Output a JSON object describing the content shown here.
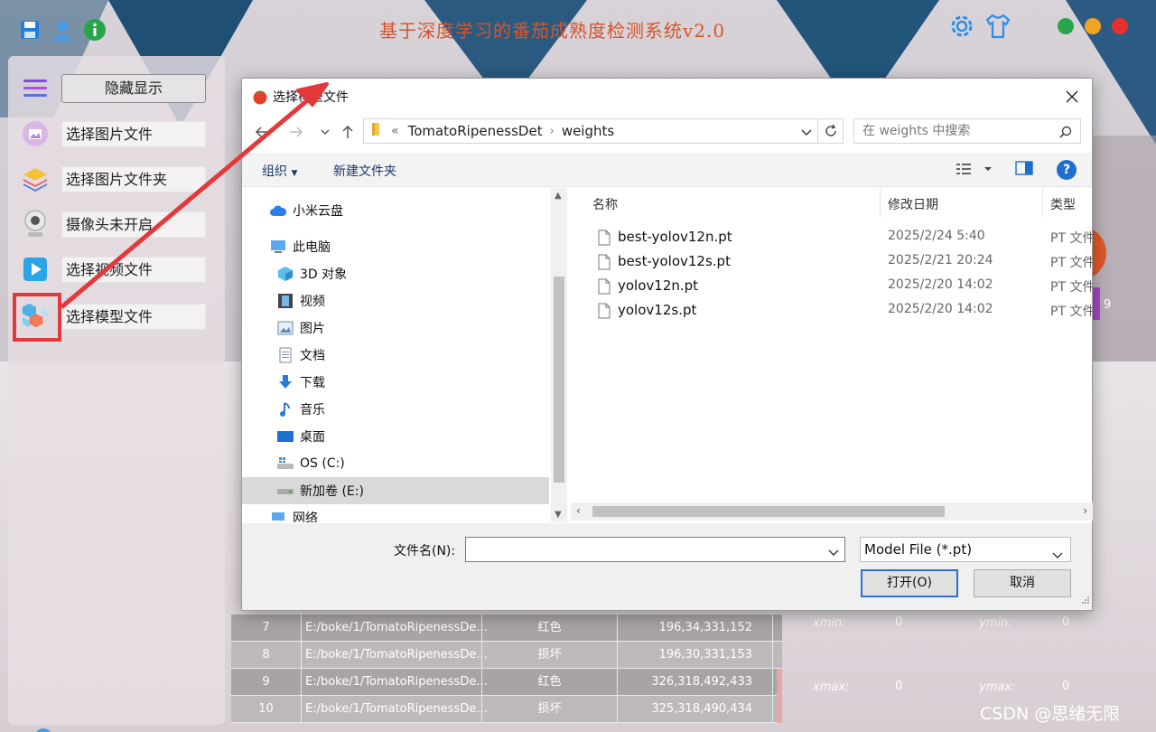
{
  "app": {
    "title": "基于深度学习的番茄成熟度检测系统v2.0",
    "window_dots": [
      "#2aa44a",
      "#f0a420",
      "#e5302b"
    ]
  },
  "sidebar": {
    "toggle_label": "隐藏显示",
    "items": [
      {
        "label": "选择图片文件",
        "icon": "image-icon"
      },
      {
        "label": "选择图片文件夹",
        "icon": "layers-folder-icon"
      },
      {
        "label": "摄像头未开启",
        "icon": "webcam-icon"
      },
      {
        "label": "选择视频文件",
        "icon": "video-play-icon"
      },
      {
        "label": "选择模型文件",
        "icon": "model-cubes-icon"
      }
    ]
  },
  "bg_table": {
    "rows": [
      {
        "id": "7",
        "path": "E:/boke/1/TomatoRipenessDe...",
        "class": "红色",
        "box": "196,34,331,152"
      },
      {
        "id": "8",
        "path": "E:/boke/1/TomatoRipenessDe...",
        "class": "损坏",
        "box": "196,30,331,153"
      },
      {
        "id": "9",
        "path": "E:/boke/1/TomatoRipenessDe...",
        "class": "红色",
        "box": "326,318,492,433"
      },
      {
        "id": "10",
        "path": "E:/boke/1/TomatoRipenessDe...",
        "class": "损坏",
        "box": "325,318,490,434"
      }
    ]
  },
  "coords": {
    "xmin_label": "xmin:",
    "xmin": "0",
    "ymin_label": "ymin:",
    "ymin": "0",
    "xmax_label": "xmax:",
    "xmax": "0",
    "ymax_label": "ymax:",
    "ymax": "0"
  },
  "side_digit": "9",
  "watermark": "CSDN @思绪无限",
  "dialog": {
    "title": "选择模型文件",
    "breadcrumb": {
      "prefix": "«",
      "parts": [
        "TomatoRipenessDet",
        "weights"
      ]
    },
    "search_placeholder": "在 weights 中搜索",
    "organize": "组织",
    "new_folder": "新建文件夹",
    "help": "?",
    "tree": [
      {
        "label": "小米云盘",
        "icon": "cloud-icon"
      },
      {
        "label": "此电脑",
        "icon": "computer-icon"
      },
      {
        "label": "3D 对象",
        "icon": "cube-3d-icon"
      },
      {
        "label": "视频",
        "icon": "film-icon"
      },
      {
        "label": "图片",
        "icon": "picture-icon"
      },
      {
        "label": "文档",
        "icon": "document-icon"
      },
      {
        "label": "下载",
        "icon": "download-icon"
      },
      {
        "label": "音乐",
        "icon": "music-icon"
      },
      {
        "label": "桌面",
        "icon": "desktop-icon"
      },
      {
        "label": "OS (C:)",
        "icon": "drive-c-icon"
      },
      {
        "label": "新加卷 (E:)",
        "icon": "drive-e-icon"
      },
      {
        "label": "网络",
        "icon": "network-icon"
      }
    ],
    "columns": {
      "name": "名称",
      "date": "修改日期",
      "type": "类型"
    },
    "files": [
      {
        "name": "best-yolov12n.pt",
        "date": "2025/2/24 5:40",
        "type": "PT 文件"
      },
      {
        "name": "best-yolov12s.pt",
        "date": "2025/2/21 20:24",
        "type": "PT 文件"
      },
      {
        "name": "yolov12n.pt",
        "date": "2025/2/20 14:02",
        "type": "PT 文件"
      },
      {
        "name": "yolov12s.pt",
        "date": "2025/2/20 14:02",
        "type": "PT 文件"
      }
    ],
    "filename_label": "文件名(N):",
    "filename_value": "",
    "filetype": "Model File (*.pt)",
    "open_label": "打开(O)",
    "cancel_label": "取消"
  }
}
